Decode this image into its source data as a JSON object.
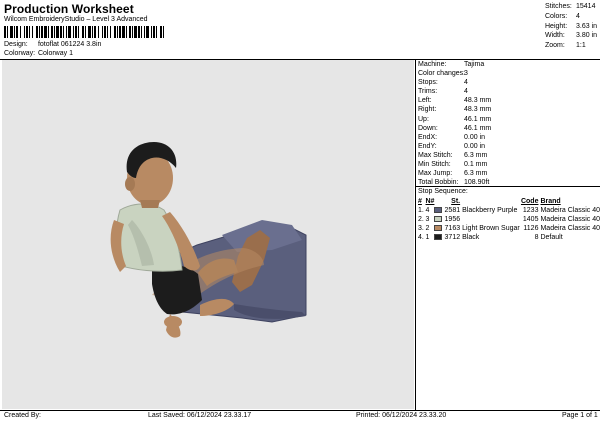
{
  "header": {
    "title": "Production Worksheet",
    "subtitle": "Wilcom EmbroideryStudio – Level 3 Advanced",
    "design_label": "Design:",
    "design_value": "fotoflat 061224 3.8in",
    "colorway_label": "Colorway:",
    "colorway_value": "Colorway 1"
  },
  "stats": [
    {
      "label": "Stitches:",
      "value": "15414"
    },
    {
      "label": "Colors:",
      "value": "4"
    },
    {
      "label": "Height:",
      "value": "3.63 in"
    },
    {
      "label": "Width:",
      "value": "3.80 in"
    },
    {
      "label": "Zoom:",
      "value": "1:1"
    }
  ],
  "details": [
    {
      "label": "Machine:",
      "value": "Tajima"
    },
    {
      "label": "Color changes:",
      "value": "3"
    },
    {
      "label": "Stops:",
      "value": "4"
    },
    {
      "label": "Trims:",
      "value": "4"
    },
    {
      "label": "Left:",
      "value": "48.3 mm"
    },
    {
      "label": "Right:",
      "value": "48.3 mm"
    },
    {
      "label": "Up:",
      "value": "46.1 mm"
    },
    {
      "label": "Down:",
      "value": "46.1 mm"
    },
    {
      "label": "EndX:",
      "value": "0.00 in"
    },
    {
      "label": "EndY:",
      "value": "0.00 in"
    },
    {
      "label": "Max Stitch:",
      "value": "6.3 mm"
    },
    {
      "label": "Min Stitch:",
      "value": "0.1 mm"
    },
    {
      "label": "Max Jump:",
      "value": "6.3 mm"
    },
    {
      "label": "Total Bobbin:",
      "value": "108.90ft"
    }
  ],
  "stop_sequence": {
    "title": "Stop Sequence:",
    "headers": {
      "num": "#",
      "n": "N#",
      "st": "St.",
      "name": "",
      "code": "Code",
      "brand": "Brand"
    },
    "rows": [
      {
        "num": "1.",
        "n": "4",
        "color": "#5a5f7d",
        "st": "2581",
        "name": "Blackberry Purple",
        "code": "1233",
        "brand": "Madeira Classic 40"
      },
      {
        "num": "2.",
        "n": "3",
        "color": "#c9d3c0",
        "st": "1956",
        "name": "",
        "code": "1405",
        "brand": "Madeira Classic 40"
      },
      {
        "num": "3.",
        "n": "2",
        "color": "#b88a63",
        "st": "7163",
        "name": "Light Brown Sugar",
        "code": "1126",
        "brand": "Madeira Classic 40"
      },
      {
        "num": "4.",
        "n": "1",
        "color": "#1c1c1c",
        "st": "3712",
        "name": "Black",
        "code": "8",
        "brand": "Default"
      }
    ]
  },
  "footer": {
    "created_by": "Created By:",
    "last_saved": "Last Saved: 06/12/2024 23.33.17",
    "printed": "Printed: 06/12/2024 23.33.20",
    "page": "Page 1 of 1"
  },
  "colors": {
    "design_background": "#e6e6e6",
    "skin": "#b88a63",
    "shirt": "#c9d3c0",
    "pants": "#5a5f7d",
    "hair": "#1c1c1c"
  }
}
